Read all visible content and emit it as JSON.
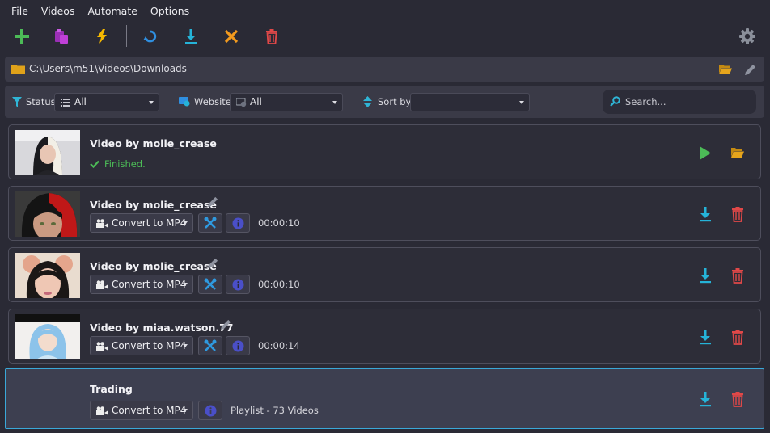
{
  "menu": [
    "File",
    "Videos",
    "Automate",
    "Options"
  ],
  "toolbar": {
    "icons": [
      "add-icon",
      "paste-icon",
      "lightning-icon",
      "refresh-icon",
      "download-icon",
      "cancel-icon",
      "delete-icon",
      "settings-icon"
    ],
    "colors": {
      "add": "#4cbb57",
      "paste": "#b03cc8",
      "lightning": "#f5b800",
      "refresh": "#2f8fe0",
      "download": "#25b3d8",
      "cancel": "#f29a1e",
      "delete": "#e04848",
      "settings": "#8a8f9a"
    }
  },
  "path": {
    "value": "C:\\Users\\m51\\Videos\\Downloads"
  },
  "filters": {
    "status_label": "Status",
    "status_value": "All",
    "website_label": "Website",
    "website_value": "All",
    "sort_label": "Sort by",
    "sort_value": "",
    "search_placeholder": "Search..."
  },
  "items": [
    {
      "title": "Video by molie_crease",
      "status": "Finished.",
      "state": "finished",
      "thumb": "thumb-1"
    },
    {
      "title": "Video by molie_crease",
      "convert": "Convert to MP4",
      "duration": "00:00:10",
      "thumb": "thumb-2"
    },
    {
      "title": "Video by molie_crease",
      "convert": "Convert to MP4",
      "duration": "00:00:10",
      "thumb": "thumb-3"
    },
    {
      "title": "Video by miaa.watson.77",
      "convert": "Convert to MP4",
      "duration": "00:00:14",
      "thumb": "thumb-4"
    },
    {
      "title": "Trading",
      "convert": "Convert to MP4",
      "info": "Playlist - 73 Videos",
      "selected": true
    }
  ]
}
